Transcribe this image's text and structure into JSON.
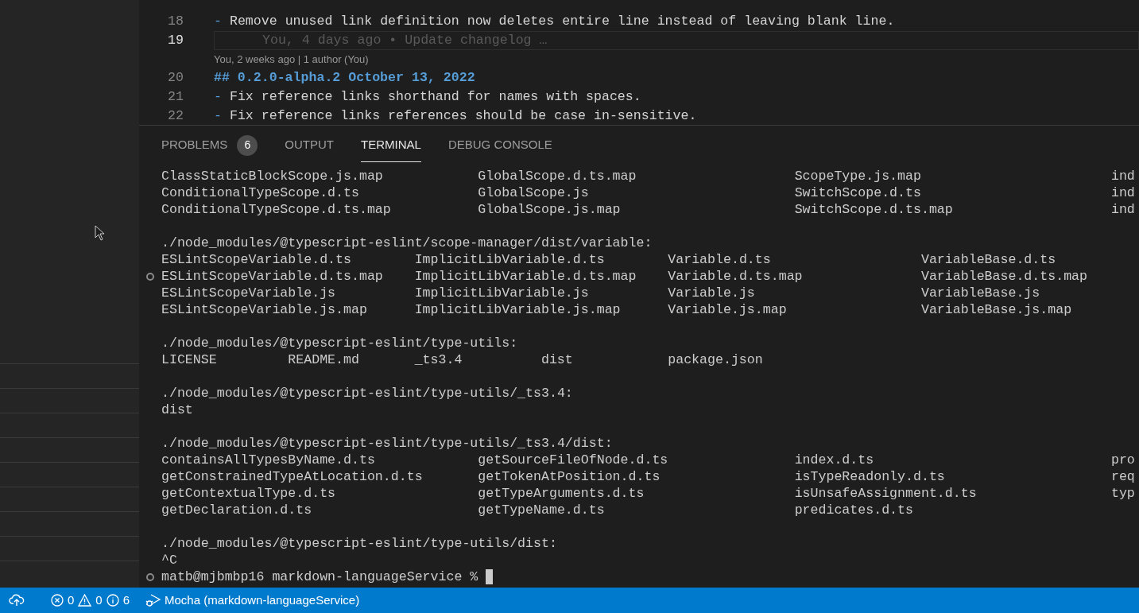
{
  "editor": {
    "lines": [
      {
        "number": "18",
        "kind": "bullet",
        "text": "Remove unused link definition now deletes entire line instead of leaving blank line.",
        "marker": "-"
      },
      {
        "number": "19",
        "kind": "blame",
        "current": true,
        "text": "You, 4 days ago • Update changelog …"
      },
      {
        "kind": "codelens",
        "text": "You, 2 weeks ago | 1 author (You)"
      },
      {
        "number": "20",
        "kind": "heading",
        "text": "## 0.2.0-alpha.2 October 13, 2022"
      },
      {
        "number": "21",
        "kind": "bullet",
        "text": "Fix reference links shorthand for names with spaces.",
        "marker": "-"
      },
      {
        "number": "22",
        "kind": "bullet",
        "text": "Fix reference links references should be case in-sensitive.",
        "marker": "-"
      }
    ]
  },
  "panel": {
    "tabs": [
      {
        "label": "PROBLEMS",
        "badge": "6",
        "selected": false
      },
      {
        "label": "OUTPUT",
        "selected": false
      },
      {
        "label": "TERMINAL",
        "selected": true
      },
      {
        "label": "DEBUG CONSOLE",
        "selected": false
      }
    ],
    "terminal": {
      "blocks": [
        {
          "rows": [
            {
              "marker": false,
              "cells": [
                "ClassStaticBlockScope.js.map",
                "GlobalScope.d.ts.map",
                "ScopeType.js.map",
                "ind"
              ]
            },
            {
              "marker": false,
              "cells": [
                "ConditionalTypeScope.d.ts",
                "GlobalScope.js",
                "SwitchScope.d.ts",
                "ind"
              ]
            },
            {
              "marker": false,
              "cells": [
                "ConditionalTypeScope.d.ts.map",
                "GlobalScope.js.map",
                "SwitchScope.d.ts.map",
                "ind"
              ]
            }
          ]
        },
        {
          "header": "./node_modules/@typescript-eslint/scope-manager/dist/variable:",
          "rows": [
            {
              "marker": false,
              "cells": [
                "ESLintScopeVariable.d.ts",
                "ImplicitLibVariable.d.ts",
                "Variable.d.ts",
                "VariableBase.d.ts"
              ]
            },
            {
              "marker": true,
              "cells": [
                "ESLintScopeVariable.d.ts.map",
                "ImplicitLibVariable.d.ts.map",
                "Variable.d.ts.map",
                "VariableBase.d.ts.map"
              ]
            },
            {
              "marker": false,
              "cells": [
                "ESLintScopeVariable.js",
                "ImplicitLibVariable.js",
                "Variable.js",
                "VariableBase.js"
              ]
            },
            {
              "marker": false,
              "cells": [
                "ESLintScopeVariable.js.map",
                "ImplicitLibVariable.js.map",
                "Variable.js.map",
                "VariableBase.js.map"
              ]
            }
          ]
        },
        {
          "header": "./node_modules/@typescript-eslint/type-utils:",
          "rows": [
            {
              "marker": false,
              "cells": [
                "LICENSE",
                "README.md",
                "_ts3.4",
                "dist",
                "package.json"
              ]
            }
          ]
        },
        {
          "header": "./node_modules/@typescript-eslint/type-utils/_ts3.4:",
          "rows": [
            {
              "marker": false,
              "cells": [
                "dist"
              ]
            }
          ]
        },
        {
          "header": "./node_modules/@typescript-eslint/type-utils/_ts3.4/dist:",
          "rows": [
            {
              "marker": false,
              "cells": [
                "containsAllTypesByName.d.ts",
                "getSourceFileOfNode.d.ts",
                "index.d.ts",
                "pro"
              ]
            },
            {
              "marker": false,
              "cells": [
                "getConstrainedTypeAtLocation.d.ts",
                "getTokenAtPosition.d.ts",
                "isTypeReadonly.d.ts",
                "req"
              ]
            },
            {
              "marker": false,
              "cells": [
                "getContextualType.d.ts",
                "getTypeArguments.d.ts",
                "isUnsafeAssignment.d.ts",
                "typ"
              ]
            },
            {
              "marker": false,
              "cells": [
                "getDeclaration.d.ts",
                "getTypeName.d.ts",
                "predicates.d.ts"
              ]
            }
          ]
        },
        {
          "header": "./node_modules/@typescript-eslint/type-utils/dist:",
          "rows": [
            {
              "marker": false,
              "cells": [
                "^C"
              ]
            }
          ]
        }
      ],
      "prompt": {
        "marker": true,
        "text": "matb@mjbmbp16 markdown-languageService %"
      }
    }
  },
  "status_bar": {
    "errors": "0",
    "warnings": "0",
    "infos": "6",
    "debug": "Mocha (markdown-languageService)"
  }
}
